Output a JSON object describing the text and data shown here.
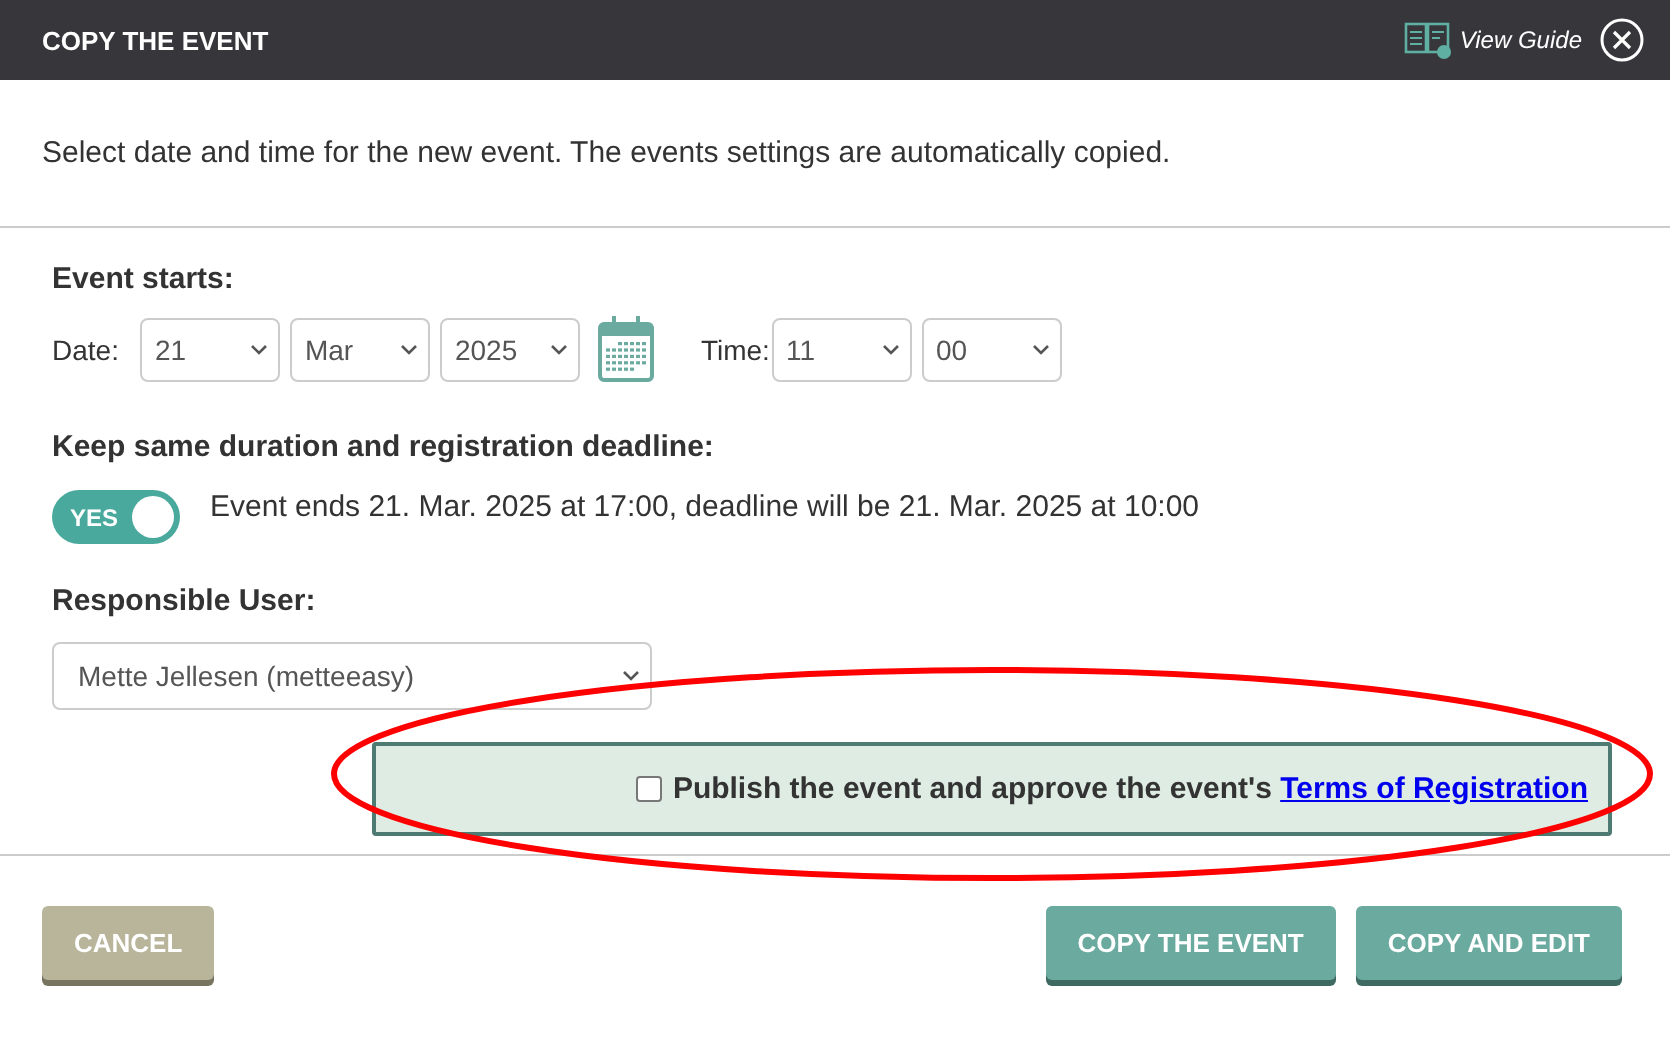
{
  "header": {
    "title": "COPY THE EVENT",
    "guide_link": "View Guide"
  },
  "intro": "Select date and time for the new event. The events settings are automatically copied.",
  "event_starts": {
    "heading": "Event starts:",
    "date_label": "Date:",
    "day": "21",
    "month": "Mar",
    "year": "2025",
    "time_label": "Time:",
    "hour": "11",
    "minute": "00"
  },
  "duration": {
    "heading": "Keep same duration and registration deadline:",
    "toggle_label": "YES",
    "on": true,
    "summary": "Event ends 21. Mar. 2025 at 17:00, deadline will be 21. Mar. 2025 at 10:00"
  },
  "responsible": {
    "heading": "Responsible User:",
    "value": "Mette Jellesen (metteeasy)"
  },
  "publish": {
    "checked": false,
    "text": "Publish the event and approve the event's",
    "link": "Terms of Registration",
    "highlighted": true
  },
  "buttons": [
    {
      "label": "CANCEL",
      "kind": "secondary"
    },
    {
      "label": "COPY THE EVENT",
      "kind": "primary"
    },
    {
      "label": "COPY AND EDIT",
      "kind": "primary"
    }
  ]
}
